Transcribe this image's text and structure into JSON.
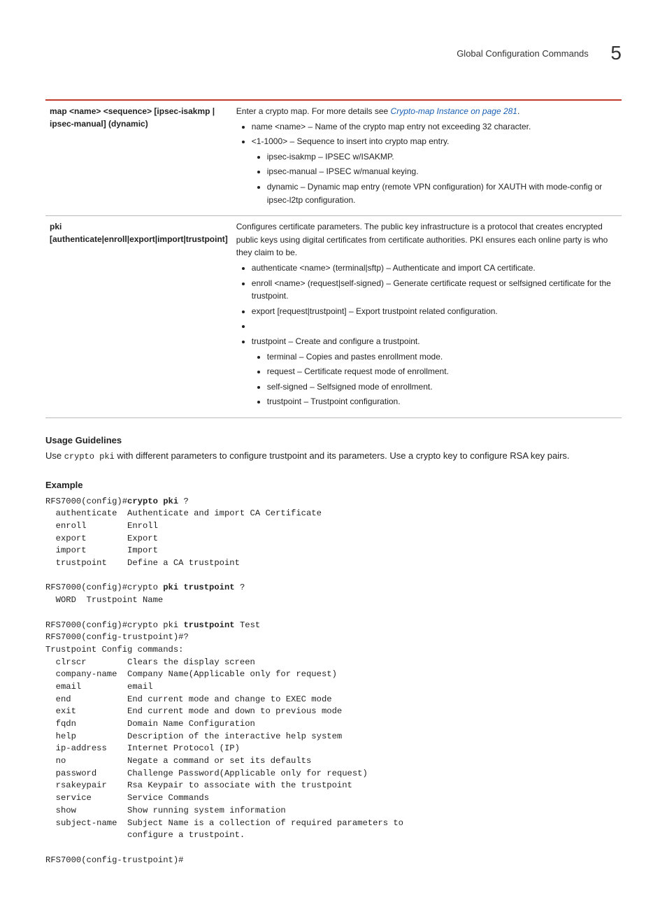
{
  "header": {
    "title": "Global Configuration Commands",
    "chapter": "5"
  },
  "table": {
    "row1": {
      "left": "map <name> <sequence> [ipsec-isakmp | ipsec-manual] (dynamic)",
      "intro_a": "Enter a crypto map. For more details see ",
      "intro_link": "Crypto-map Instance on page 281",
      "intro_b": ".",
      "b1": "name <name> – Name of the crypto map entry not exceeding 32 character.",
      "b2": "<1-1000> – Sequence to insert into crypto map entry.",
      "b2a": "ipsec-isakmp – IPSEC w/ISAKMP.",
      "b2b": "ipsec-manual – IPSEC w/manual keying.",
      "b2c": "dynamic – Dynamic map entry (remote VPN configuration) for XAUTH with mode-config or ipsec-l2tp configuration."
    },
    "row2": {
      "left": "pki [authenticate|enroll|export|import|trustpoint]",
      "intro": "Configures certificate parameters. The public key infrastructure is a protocol that creates encrypted public keys using digital certificates from certificate authorities. PKI ensures each online party is who they claim to be.",
      "b1": "authenticate <name> (terminal|sftp) – Authenticate and import CA certificate.",
      "b2": "enroll <name> (request|self-signed) – Generate certificate request or selfsigned certificate for the trustpoint.",
      "b3": "export [request|trustpoint] – Export trustpoint related configuration.",
      "b4": "",
      "b5": "trustpoint – Create and configure a trustpoint.",
      "s1": "terminal – Copies and pastes enrollment mode.",
      "s2": "request – Certificate request mode of enrollment.",
      "s3": "self-signed – Selfsigned mode of enrollment.",
      "s4": "trustpoint – Trustpoint configuration."
    }
  },
  "usage": {
    "heading": "Usage Guidelines",
    "text_a": "Use ",
    "text_mono": "crypto pki",
    "text_b": " with different parameters to configure trustpoint and its parameters. Use a crypto key to configure RSA key pairs."
  },
  "example": {
    "heading": "Example",
    "line01a": "RFS7000(config)#",
    "line01b": "crypto pki",
    "line01c": " ?",
    "line02": "  authenticate  Authenticate and import CA Certificate",
    "line03": "  enroll        Enroll",
    "line04": "  export        Export",
    "line05": "  import        Import",
    "line06": "  trustpoint    Define a CA trustpoint",
    "line07": "",
    "line08a": "RFS7000(config)#crypto ",
    "line08b": "pki trustpoint",
    "line08c": " ?",
    "line09": "  WORD  Trustpoint Name",
    "line10": "",
    "line11a": "RFS7000(config)#crypto pki ",
    "line11b": "trustpoint",
    "line11c": " Test",
    "line12": "RFS7000(config-trustpoint)#?",
    "line13": "Trustpoint Config commands:",
    "line14": "  clrscr        Clears the display screen",
    "line15": "  company-name  Company Name(Applicable only for request)",
    "line16": "  email         email",
    "line17": "  end           End current mode and change to EXEC mode",
    "line18": "  exit          End current mode and down to previous mode",
    "line19": "  fqdn          Domain Name Configuration",
    "line20": "  help          Description of the interactive help system",
    "line21": "  ip-address    Internet Protocol (IP)",
    "line22": "  no            Negate a command or set its defaults",
    "line23": "  password      Challenge Password(Applicable only for request)",
    "line24": "  rsakeypair    Rsa Keypair to associate with the trustpoint",
    "line25": "  service       Service Commands",
    "line26": "  show          Show running system information",
    "line27": "  subject-name  Subject Name is a collection of required parameters to",
    "line28": "                configure a trustpoint.",
    "line29": "",
    "line30": "RFS7000(config-trustpoint)#"
  }
}
